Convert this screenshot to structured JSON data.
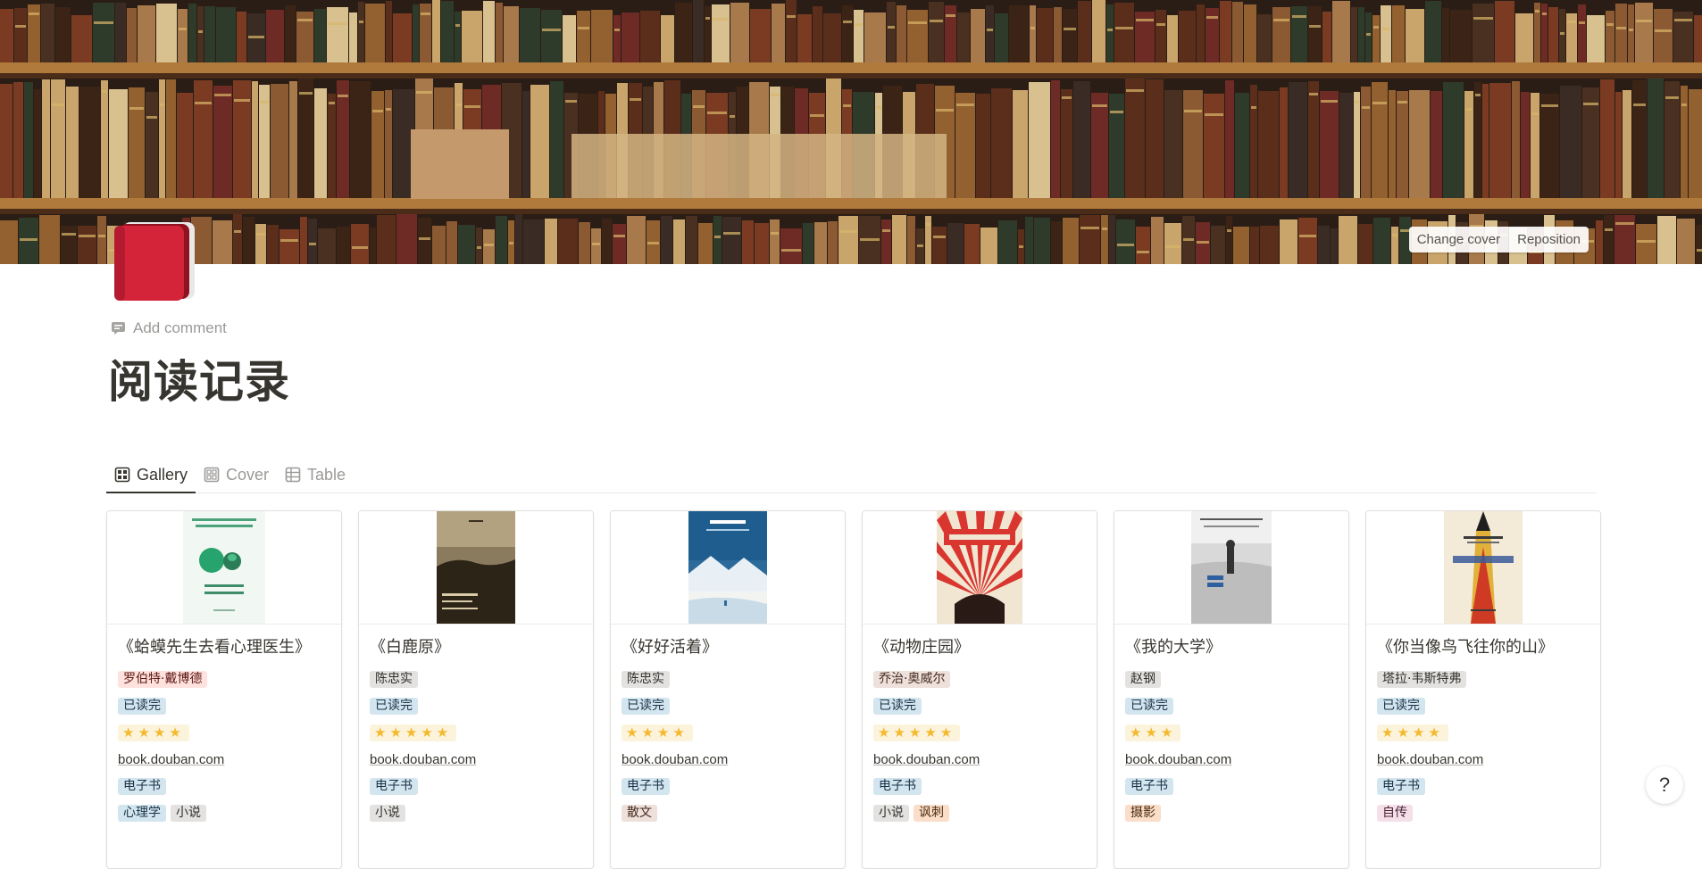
{
  "cover": {
    "change_label": "Change cover",
    "reposition_label": "Reposition",
    "bg_colors": [
      "#2a1d15",
      "#6b3b20",
      "#b07a3c",
      "#d4b483"
    ]
  },
  "page": {
    "icon": "closed-red-book-icon",
    "add_comment": "Add comment",
    "title": "阅读记录"
  },
  "tabs": [
    {
      "label": "Gallery",
      "icon": "gallery-icon",
      "active": true
    },
    {
      "label": "Cover",
      "icon": "gallery-icon",
      "active": false
    },
    {
      "label": "Table",
      "icon": "table-icon",
      "active": false
    }
  ],
  "colors": {
    "status_bg": "#d3e5ef",
    "rating_bg": "#fbf3db",
    "star": "#f5b92e"
  },
  "books": [
    {
      "title": "《蛤蟆先生去看心理医生》",
      "author": "罗伯特·戴博德",
      "status": "已读完",
      "rating": 4,
      "stars": "★★★★",
      "link": "book.douban.com",
      "format": "电子书",
      "tags": [
        "心理学",
        "小说"
      ]
    },
    {
      "title": "《白鹿原》",
      "author": "陈忠实",
      "status": "已读完",
      "rating": 5,
      "stars": "★★★★★",
      "link": "book.douban.com",
      "format": "电子书",
      "tags": [
        "小说"
      ]
    },
    {
      "title": "《好好活着》",
      "author": "陈忠实",
      "status": "已读完",
      "rating": 4,
      "stars": "★★★★",
      "link": "book.douban.com",
      "format": "电子书",
      "tags": [
        "散文"
      ]
    },
    {
      "title": "《动物庄园》",
      "author": "乔治·奥威尔",
      "status": "已读完",
      "rating": 5,
      "stars": "★★★★★",
      "link": "book.douban.com",
      "format": "电子书",
      "tags": [
        "小说",
        "讽刺"
      ]
    },
    {
      "title": "《我的大学》",
      "author": "赵钢",
      "status": "已读完",
      "rating": 3,
      "stars": "★★★",
      "link": "book.douban.com",
      "format": "电子书",
      "tags": [
        "摄影"
      ]
    },
    {
      "title": "《你当像鸟飞往你的山》",
      "author": "塔拉·韦斯特弗",
      "status": "已读完",
      "rating": 4,
      "stars": "★★★★",
      "link": "book.douban.com",
      "format": "电子书",
      "tags": [
        "自传"
      ]
    }
  ],
  "help_label": "?"
}
